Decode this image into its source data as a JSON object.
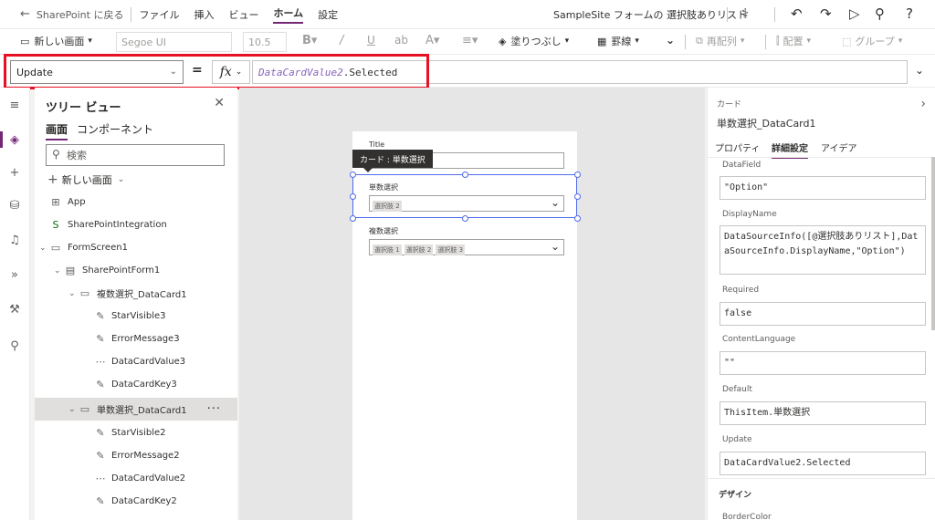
{
  "menubar": {
    "back_label": "SharePoint に戻る",
    "menus": [
      "ファイル",
      "挿入",
      "ビュー",
      "ホーム",
      "設定"
    ],
    "active_menu": "ホーム",
    "app_title": "SampleSite フォームの 選択肢ありリスト",
    "icons": [
      "stethoscope-icon",
      "undo-icon",
      "redo-icon",
      "play-icon",
      "person-icon",
      "help-icon"
    ]
  },
  "toolbar": {
    "new_screen": "新しい画面",
    "font": "Segoe UI",
    "font_size": "10.5",
    "fill": "塗りつぶし",
    "border": "罫線",
    "reorder": "再配列",
    "align": "配置",
    "group": "グループ"
  },
  "formula_bar": {
    "property": "Update",
    "equals": "=",
    "fx": "fx",
    "formula_var": "DataCardValue2",
    "formula_prop": ".Selected"
  },
  "tree": {
    "title": "ツリー ビュー",
    "tabs": [
      "画面",
      "コンポーネント"
    ],
    "search_placeholder": "検索",
    "new_screen": "新しい画面",
    "items": [
      {
        "label": "App",
        "icon": "app-icon",
        "level": 0
      },
      {
        "label": "SharePointIntegration",
        "icon": "sharepoint-icon",
        "level": 0
      },
      {
        "label": "FormScreen1",
        "icon": "screen-icon",
        "level": 0
      },
      {
        "label": "SharePointForm1",
        "icon": "form-icon",
        "level": 1
      },
      {
        "label": "複数選択_DataCard1",
        "icon": "card-icon",
        "level": 2
      },
      {
        "label": "StarVisible3",
        "icon": "label-icon",
        "level": 3
      },
      {
        "label": "ErrorMessage3",
        "icon": "label-icon",
        "level": 3
      },
      {
        "label": "DataCardValue3",
        "icon": "combobox-icon",
        "level": 3
      },
      {
        "label": "DataCardKey3",
        "icon": "label-icon",
        "level": 3
      },
      {
        "label": "単数選択_DataCard1",
        "icon": "card-icon",
        "level": 2
      },
      {
        "label": "StarVisible2",
        "icon": "label-icon",
        "level": 3
      },
      {
        "label": "ErrorMessage2",
        "icon": "label-icon",
        "level": 3
      },
      {
        "label": "DataCardValue2",
        "icon": "combobox-icon",
        "level": 3
      },
      {
        "label": "DataCardKey2",
        "icon": "label-icon",
        "level": 3
      }
    ]
  },
  "canvas": {
    "title_label": "Title",
    "tooltip": "カード : 単数選択",
    "single_label": "単数選択",
    "single_tags": [
      "選択肢 2"
    ],
    "multi_label": "複数選択",
    "multi_tags": [
      "選択肢 1",
      "選択肢 2",
      "選択肢 3"
    ]
  },
  "right_panel": {
    "kind": "カード",
    "name": "単数選択_DataCard1",
    "tabs": [
      "プロパティ",
      "詳細設定",
      "アイデア"
    ],
    "active_tab": "詳細設定",
    "props": [
      {
        "label": "DataField",
        "value": "\"Option\""
      },
      {
        "label": "DisplayName",
        "value": "DataSourceInfo([@選択肢ありリスト],DataSourceInfo.DisplayName,\"Option\")"
      },
      {
        "label": "Required",
        "value": "false"
      },
      {
        "label": "ContentLanguage",
        "value": "\"\""
      },
      {
        "label": "Default",
        "value": "ThisItem.単数選択"
      },
      {
        "label": "Update",
        "value": "DataCardValue2.Selected"
      }
    ],
    "section": "デザイン",
    "next_label": "BorderColor"
  },
  "colors": {
    "accent": "#742774",
    "highlight": "#e81123",
    "selection": "#4f6bed"
  }
}
